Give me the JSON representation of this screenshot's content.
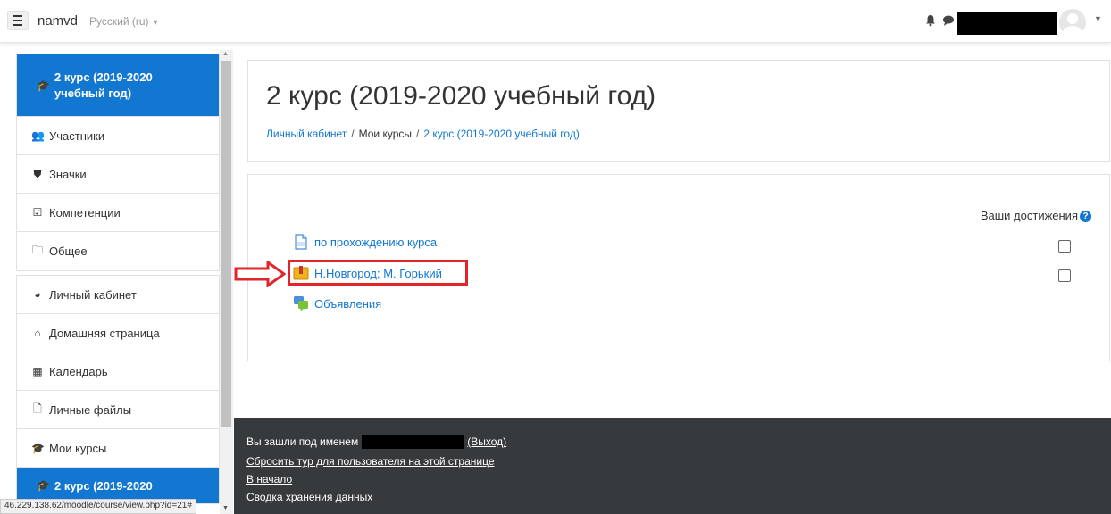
{
  "navbar": {
    "site_name": "namvd",
    "language": "Русский (ru)"
  },
  "sidebar": {
    "group1": [
      {
        "label": "2 курс (2019-2020 учебный год)",
        "icon": "graduation-cap-icon",
        "active": true
      },
      {
        "label": "Участники",
        "icon": "users-icon"
      },
      {
        "label": "Значки",
        "icon": "shield-icon"
      },
      {
        "label": "Компетенции",
        "icon": "checkbox-icon"
      },
      {
        "label": "Общее",
        "icon": "folder-icon"
      }
    ],
    "group2": [
      {
        "label": "Личный кабинет",
        "icon": "dashboard-icon"
      },
      {
        "label": "Домашняя страница",
        "icon": "home-icon"
      },
      {
        "label": "Календарь",
        "icon": "calendar-icon"
      },
      {
        "label": "Личные файлы",
        "icon": "file-icon"
      },
      {
        "label": "Мои курсы",
        "icon": "graduation-cap-icon"
      },
      {
        "label": "2 курс (2019-2020",
        "icon": "graduation-cap-icon",
        "active": true
      }
    ]
  },
  "status_url": "46.229.138.62/moodle/course/view.php?id=21#",
  "header": {
    "title": "2 курс (2019-2020 учебный год)",
    "breadcrumb": [
      "Личный кабинет",
      "Мои курсы",
      "2 курс (2019-2020 учебный год)"
    ]
  },
  "content": {
    "progress_label": "Ваши достижения",
    "activities": [
      {
        "label": "по прохождению курса",
        "icon": "page-icon",
        "checkbox": true
      },
      {
        "label": "Н.Новгород; М. Горький",
        "icon": "lesson-icon",
        "checkbox": true
      },
      {
        "label": "Объявления",
        "icon": "forum-icon",
        "checkbox": false
      }
    ]
  },
  "footer": {
    "logged_in_prefix": "Вы зашли под именем",
    "logout": "(Выход)",
    "reset_tour": "Сбросить тур для пользователя на этой странице",
    "home": "В начало",
    "data_retention": "Сводка хранения данных"
  },
  "colors": {
    "accent": "#1177d1",
    "footer_bg": "#373a3c",
    "highlight": "#e2242b"
  }
}
